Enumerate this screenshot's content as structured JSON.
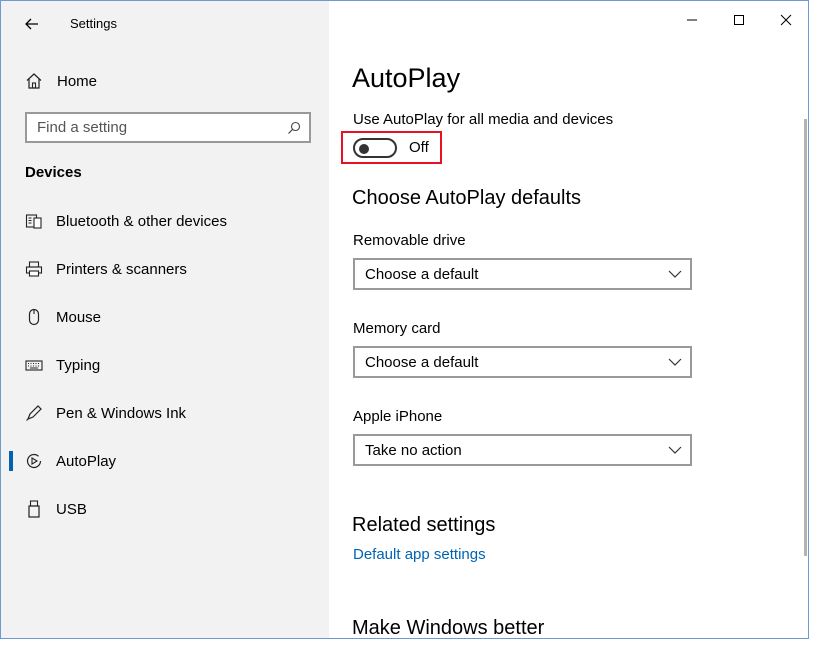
{
  "window": {
    "title": "Settings"
  },
  "sidebar": {
    "home_label": "Home",
    "search_placeholder": "Find a setting",
    "section": "Devices",
    "items": [
      {
        "label": "Bluetooth & other devices",
        "icon": "bluetooth-devices-icon"
      },
      {
        "label": "Printers & scanners",
        "icon": "printer-icon"
      },
      {
        "label": "Mouse",
        "icon": "mouse-icon"
      },
      {
        "label": "Typing",
        "icon": "keyboard-icon"
      },
      {
        "label": "Pen & Windows Ink",
        "icon": "pen-icon"
      },
      {
        "label": "AutoPlay",
        "icon": "autoplay-icon",
        "active": true
      },
      {
        "label": "USB",
        "icon": "usb-icon"
      }
    ]
  },
  "main": {
    "title": "AutoPlay",
    "autoplay_setting_label": "Use AutoPlay for all media and devices",
    "toggle_state": "Off",
    "defaults_heading": "Choose AutoPlay defaults",
    "removable_drive": {
      "label": "Removable drive",
      "value": "Choose a default"
    },
    "memory_card": {
      "label": "Memory card",
      "value": "Choose a default"
    },
    "apple_iphone": {
      "label": "Apple iPhone",
      "value": "Take no action"
    },
    "related_heading": "Related settings",
    "related_link": "Default app settings",
    "feedback_heading": "Make Windows better"
  },
  "colors": {
    "accent": "#0063b1",
    "highlight": "#e81123",
    "sidebar_bg": "#f2f2f2"
  }
}
